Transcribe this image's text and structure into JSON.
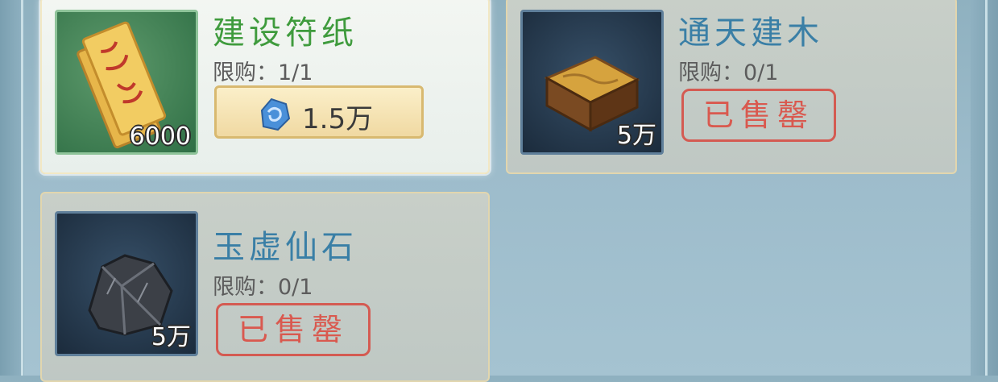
{
  "shop": {
    "items": [
      {
        "name": "建设符纸",
        "limit_label": "限购：",
        "limit_value": "1/1",
        "quantity": "6000",
        "price": "1.5万",
        "status": "available",
        "icon": "talisman-paper-icon",
        "price_icon": "jade-gem-icon"
      },
      {
        "name": "通天建木",
        "limit_label": "限购：",
        "limit_value": "0/1",
        "quantity": "5万",
        "sold_label": "已售罄",
        "status": "sold-out",
        "icon": "wood-block-icon"
      },
      {
        "name": "玉虚仙石",
        "limit_label": "限购：",
        "limit_value": "0/1",
        "quantity": "5万",
        "sold_label": "已售罄",
        "status": "sold-out",
        "icon": "immortal-stone-icon"
      }
    ]
  },
  "colors": {
    "available_name": "#3f9b3d",
    "soldout_name": "#3a7fa6",
    "sold_stamp": "#d9594f",
    "background": "#9dbccb"
  }
}
